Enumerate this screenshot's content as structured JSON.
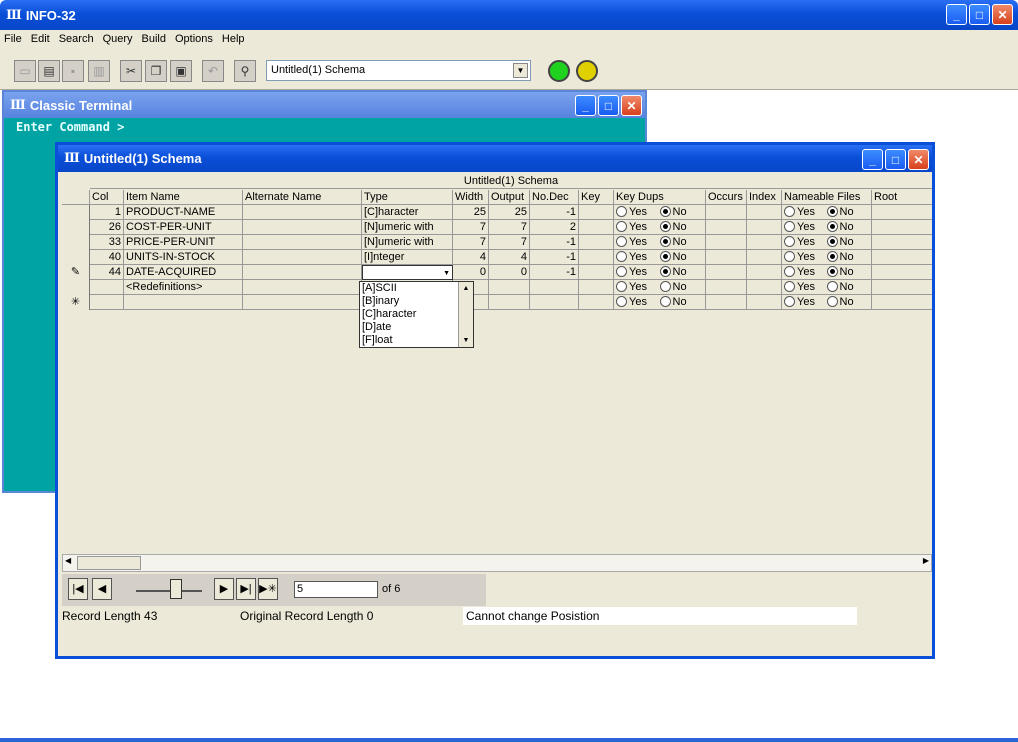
{
  "app": {
    "title": "INFO-32",
    "icon": "Ⅲ"
  },
  "menu": [
    "File",
    "Edit",
    "Search",
    "Query",
    "Build",
    "Options",
    "Help"
  ],
  "toolbar": {
    "schema_combo_value": "Untitled(1) Schema",
    "lights": {
      "green": "#1ed21e",
      "yellow": "#e0d000"
    }
  },
  "terminal": {
    "title": "Classic Terminal",
    "prompt": "Enter Command >"
  },
  "schema": {
    "title": "Untitled(1) Schema",
    "grid_title": "Untitled(1) Schema",
    "columns": [
      "Col",
      "Item Name",
      "Alternate Name",
      "Type",
      "Width",
      "Output",
      "No.Dec",
      "Key",
      "Key Dups",
      "Occurs",
      "Index",
      "Nameable Files",
      "Root"
    ],
    "radio_yes": "Yes",
    "radio_no": "No",
    "rows": [
      {
        "marker": "",
        "col": "1",
        "name": "PRODUCT-NAME",
        "alt": "",
        "type": "[C]haracter",
        "width": "25",
        "output": "25",
        "nodec": "-1"
      },
      {
        "marker": "",
        "col": "26",
        "name": "COST-PER-UNIT",
        "alt": "",
        "type": "[N]umeric with",
        "width": "7",
        "output": "7",
        "nodec": "2"
      },
      {
        "marker": "",
        "col": "33",
        "name": "PRICE-PER-UNIT",
        "alt": "",
        "type": "[N]umeric with",
        "width": "7",
        "output": "7",
        "nodec": "-1"
      },
      {
        "marker": "",
        "col": "40",
        "name": "UNITS-IN-STOCK",
        "alt": "",
        "type": "[I]nteger",
        "width": "4",
        "output": "4",
        "nodec": "-1"
      },
      {
        "marker": "✎",
        "col": "44",
        "name": "DATE-ACQUIRED",
        "alt": "",
        "type": "",
        "width": "0",
        "output": "0",
        "nodec": "-1"
      },
      {
        "marker": "",
        "col": "",
        "name": "<Redefinitions>",
        "alt": "",
        "type": "",
        "width": "",
        "output": "",
        "nodec": ""
      },
      {
        "marker": "✳",
        "col": "",
        "name": "",
        "alt": "",
        "type": "",
        "width": "",
        "output": "",
        "nodec": ""
      }
    ],
    "type_options": [
      "[A]SCII",
      "[B]inary",
      "[C]haracter",
      "[D]ate",
      "[F]loat"
    ],
    "nav": {
      "record": "5",
      "of": "of 6"
    },
    "status": {
      "record_length": "Record Length 43",
      "original_length": "Original Record Length 0",
      "message": "Cannot change Posistion"
    }
  }
}
